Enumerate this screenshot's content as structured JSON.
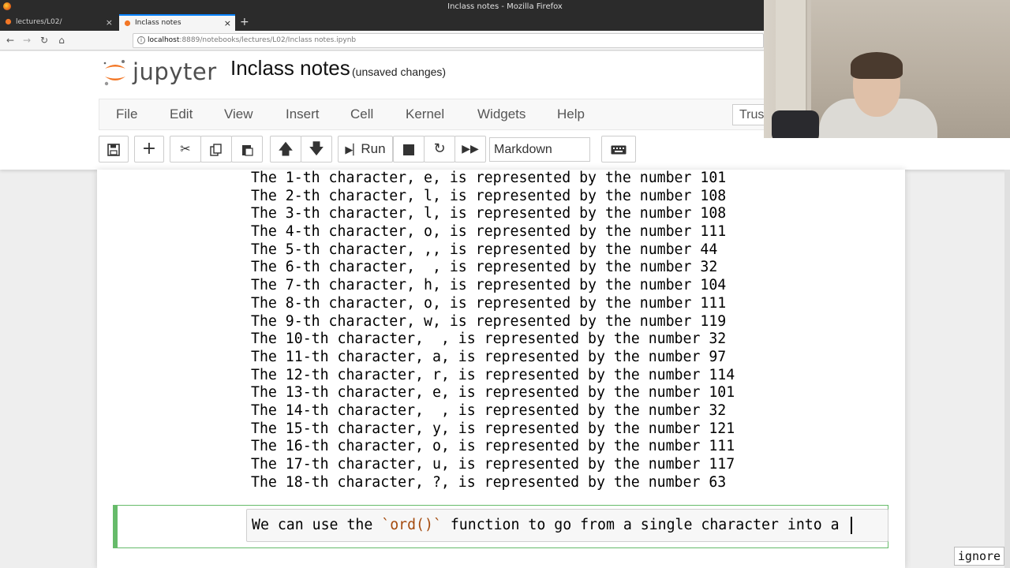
{
  "browser": {
    "window_title": "Inclass notes - Mozilla Firefox",
    "tabs": [
      {
        "label": "lectures/L02/"
      },
      {
        "label": "Inclass notes"
      }
    ],
    "url_host": "localhost",
    "url_rest": ":8889/notebooks/lectures/L02/Inclass notes.ipynb"
  },
  "jupyter": {
    "logo_text": "jupyter",
    "notebook_title": "Inclass notes",
    "save_status": "(unsaved changes)",
    "menu": [
      "File",
      "Edit",
      "View",
      "Insert",
      "Cell",
      "Kernel",
      "Widgets",
      "Help"
    ],
    "trust_label": "Trust",
    "run_label": "Run",
    "cell_type": "Markdown"
  },
  "output_lines": [
    "The 1-th character, e, is represented by the number 101",
    "The 2-th character, l, is represented by the number 108",
    "The 3-th character, l, is represented by the number 108",
    "The 4-th character, o, is represented by the number 111",
    "The 5-th character, ,, is represented by the number 44",
    "The 6-th character,  , is represented by the number 32",
    "The 7-th character, h, is represented by the number 104",
    "The 8-th character, o, is represented by the number 111",
    "The 9-th character, w, is represented by the number 119",
    "The 10-th character,  , is represented by the number 32",
    "The 11-th character, a, is represented by the number 97",
    "The 12-th character, r, is represented by the number 114",
    "The 13-th character, e, is represented by the number 101",
    "The 14-th character,  , is represented by the number 32",
    "The 15-th character, y, is represented by the number 121",
    "The 16-th character, o, is represented by the number 111",
    "The 17-th character, u, is represented by the number 117",
    "The 18-th character, ?, is represented by the number 63"
  ],
  "edit_cell": {
    "text_before": "We can use the ",
    "code": "`ord()`",
    "text_after": " function to go from a single character into a "
  },
  "ignore_label": "ignore"
}
